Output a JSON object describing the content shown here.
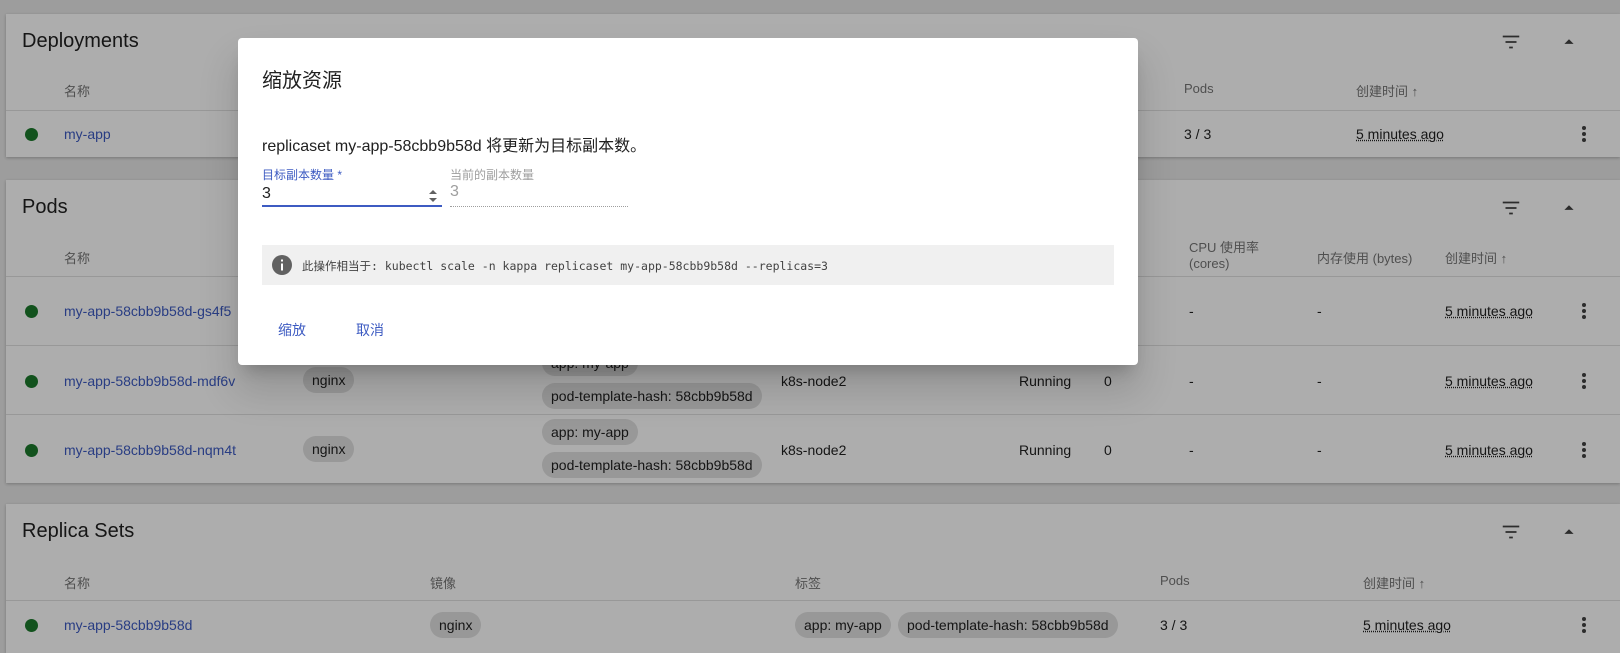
{
  "deployments": {
    "title": "Deployments",
    "columns": {
      "name": "名称",
      "pods": "Pods",
      "created": "创建时间 ↑"
    },
    "rows": [
      {
        "name": "my-app",
        "pods": "3 / 3",
        "created": "5 minutes ago"
      }
    ]
  },
  "pods": {
    "title": "Pods",
    "columns": {
      "name": "名称",
      "cpu": "CPU 使用率 (cores)",
      "mem": "内存使用 (bytes)",
      "created": "创建时间 ↑"
    },
    "rows": [
      {
        "name": "my-app-58cbb9b58d-gs4f5",
        "image": "",
        "labels": [],
        "node": "",
        "status": "",
        "restarts": "",
        "cpu": "-",
        "mem": "-",
        "created": "5 minutes ago"
      },
      {
        "name": "my-app-58cbb9b58d-mdf6v",
        "image": "nginx",
        "labels": [
          "app: my-app",
          "pod-template-hash: 58cbb9b58d"
        ],
        "node": "k8s-node2",
        "status": "Running",
        "restarts": "0",
        "cpu": "-",
        "mem": "-",
        "created": "5 minutes ago"
      },
      {
        "name": "my-app-58cbb9b58d-nqm4t",
        "image": "nginx",
        "labels": [
          "app: my-app",
          "pod-template-hash: 58cbb9b58d"
        ],
        "node": "k8s-node2",
        "status": "Running",
        "restarts": "0",
        "cpu": "-",
        "mem": "-",
        "created": "5 minutes ago"
      }
    ]
  },
  "replicasets": {
    "title": "Replica Sets",
    "columns": {
      "name": "名称",
      "image": "镜像",
      "labels": "标签",
      "pods": "Pods",
      "created": "创建时间 ↑"
    },
    "rows": [
      {
        "name": "my-app-58cbb9b58d",
        "image": "nginx",
        "labels": [
          "app: my-app",
          "pod-template-hash: 58cbb9b58d"
        ],
        "pods": "3 / 3",
        "created": "5 minutes ago"
      }
    ]
  },
  "dialog": {
    "title": "缩放资源",
    "description": "replicaset my-app-58cbb9b58d 将更新为目标副本数。",
    "target_label": "目标副本数量 *",
    "target_value": "3",
    "current_label": "当前的副本数量",
    "current_value": "3",
    "info_text": "此操作相当于: kubectl scale -n kappa replicaset my-app-58cbb9b58d --replicas=3",
    "scale_button": "缩放",
    "cancel_button": "取消"
  },
  "colors": {
    "accent": "#3d5bc2",
    "status_ok": "#1b7a2b",
    "chip_bg": "#e0e0e0"
  }
}
